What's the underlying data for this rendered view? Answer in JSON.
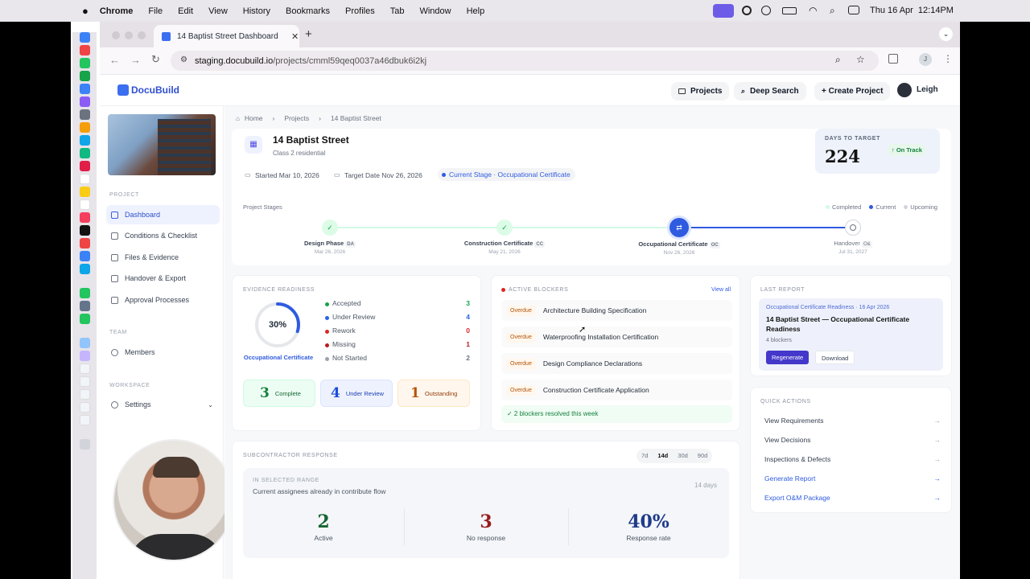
{
  "menubar": {
    "app": "Chrome",
    "items": [
      "File",
      "Edit",
      "View",
      "History",
      "Bookmarks",
      "Profiles",
      "Tab",
      "Window",
      "Help"
    ],
    "clock": "Thu 16 Apr  12:14PM"
  },
  "browser": {
    "tab_title": "14 Baptist Street Dashboard",
    "url_host": "staging.docubuild.io",
    "url_path": "/projects/cmml59qeq0037a46dbuk6i2kj",
    "profile_initial": "J"
  },
  "app": {
    "logo": "DocuBuild",
    "nav": {
      "projects": "Projects",
      "deep_search": "Deep Search",
      "create": "+ Create Project",
      "user": "Leigh"
    }
  },
  "sidebar": {
    "section_project": "PROJECT",
    "items": [
      {
        "label": "Dashboard",
        "active": true,
        "icon": "grid-icon"
      },
      {
        "label": "Conditions & Checklist",
        "active": false,
        "icon": "checklist-icon"
      },
      {
        "label": "Files & Evidence",
        "active": false,
        "icon": "folder-icon"
      },
      {
        "label": "Handover & Export",
        "active": false,
        "icon": "download-icon"
      },
      {
        "label": "Approval Processes",
        "active": false,
        "icon": "workflow-icon"
      }
    ],
    "section_team": "TEAM",
    "members": "Members",
    "section_workspace": "WORKSPACE",
    "settings": "Settings"
  },
  "breadcrumb": {
    "home": "Home",
    "projects": "Projects",
    "current": "14 Baptist Street"
  },
  "project": {
    "name": "14 Baptist Street",
    "class": "Class 2 residential",
    "started": "Started Mar 10, 2026",
    "target": "Target Date Nov 26, 2026",
    "stage": "Current Stage · Occupational Certificate",
    "days_label": "DAYS TO TARGET",
    "days": "224",
    "status": "↑ On Track"
  },
  "stages": {
    "label": "Project Stages",
    "legend": [
      "Completed",
      "Current",
      "Upcoming"
    ],
    "items": [
      {
        "name": "Design Phase",
        "code": "DA",
        "date": "Mar 26, 2026",
        "state": "completed"
      },
      {
        "name": "Construction Certificate",
        "code": "CC",
        "date": "May 21, 2026",
        "state": "completed"
      },
      {
        "name": "Occupational Certificate",
        "code": "OC",
        "date": "Nov 26, 2026",
        "state": "current"
      },
      {
        "name": "Handover",
        "code": "O&",
        "date": "Jul 31, 2027",
        "state": "upcoming"
      }
    ]
  },
  "evidence": {
    "title": "EVIDENCE READINESS",
    "percent": "30%",
    "percent_value": 0.3,
    "cert": "Occupational Certificate",
    "rows": [
      {
        "label": "Accepted",
        "count": "3",
        "color": "#16a34a"
      },
      {
        "label": "Under Review",
        "count": "4",
        "color": "#2563eb"
      },
      {
        "label": "Rework",
        "count": "0",
        "color": "#dc2626"
      },
      {
        "label": "Missing",
        "count": "1",
        "color": "#b91c1c"
      },
      {
        "label": "Not Started",
        "count": "2",
        "color": "#9ca3af"
      }
    ],
    "complete": {
      "n": "3",
      "label": "Complete"
    },
    "review": {
      "n": "4",
      "label": "Under Review"
    },
    "outstanding": {
      "n": "1",
      "label": "Outstanding"
    }
  },
  "blockers": {
    "title": "ACTIVE BLOCKERS",
    "view_all": "View all",
    "tag": "Overdue",
    "items": [
      "Architecture Building Specification",
      "Waterproofing Installation Certification",
      "Design Compliance Declarations",
      "Construction Certificate Application"
    ],
    "resolved": "✓ 2 blockers resolved this week"
  },
  "report": {
    "title": "LAST REPORT",
    "meta": "Occupational Certificate Readiness · 16 Apr 2026",
    "heading": "14 Baptist Street — Occupational Certificate Readiness",
    "blockers": "4 blockers",
    "regenerate": "Regenerate",
    "download": "Download"
  },
  "quick": {
    "title": "QUICK ACTIONS",
    "items": [
      {
        "label": "View Requirements",
        "link": false
      },
      {
        "label": "View Decisions",
        "link": false
      },
      {
        "label": "Inspections & Defects",
        "link": false
      },
      {
        "label": "Generate Report",
        "link": true
      },
      {
        "label": "Export O&M Package",
        "link": true
      }
    ]
  },
  "subcontractor": {
    "title": "SUBCONTRACTOR RESPONSE",
    "ranges": [
      "7d",
      "14d",
      "30d",
      "90d"
    ],
    "active_range": "14d",
    "range_label": "IN SELECTED RANGE",
    "desc": "Current assignees already in contribute flow",
    "days": "14 days",
    "active": {
      "n": "2",
      "label": "Active"
    },
    "noresp": {
      "n": "3",
      "label": "No response"
    },
    "rate": {
      "n": "40%",
      "label": "Response rate"
    }
  },
  "colors": {
    "accent": "#2f5be0",
    "green": "#16a34a",
    "brand": "#3b5bdb"
  }
}
